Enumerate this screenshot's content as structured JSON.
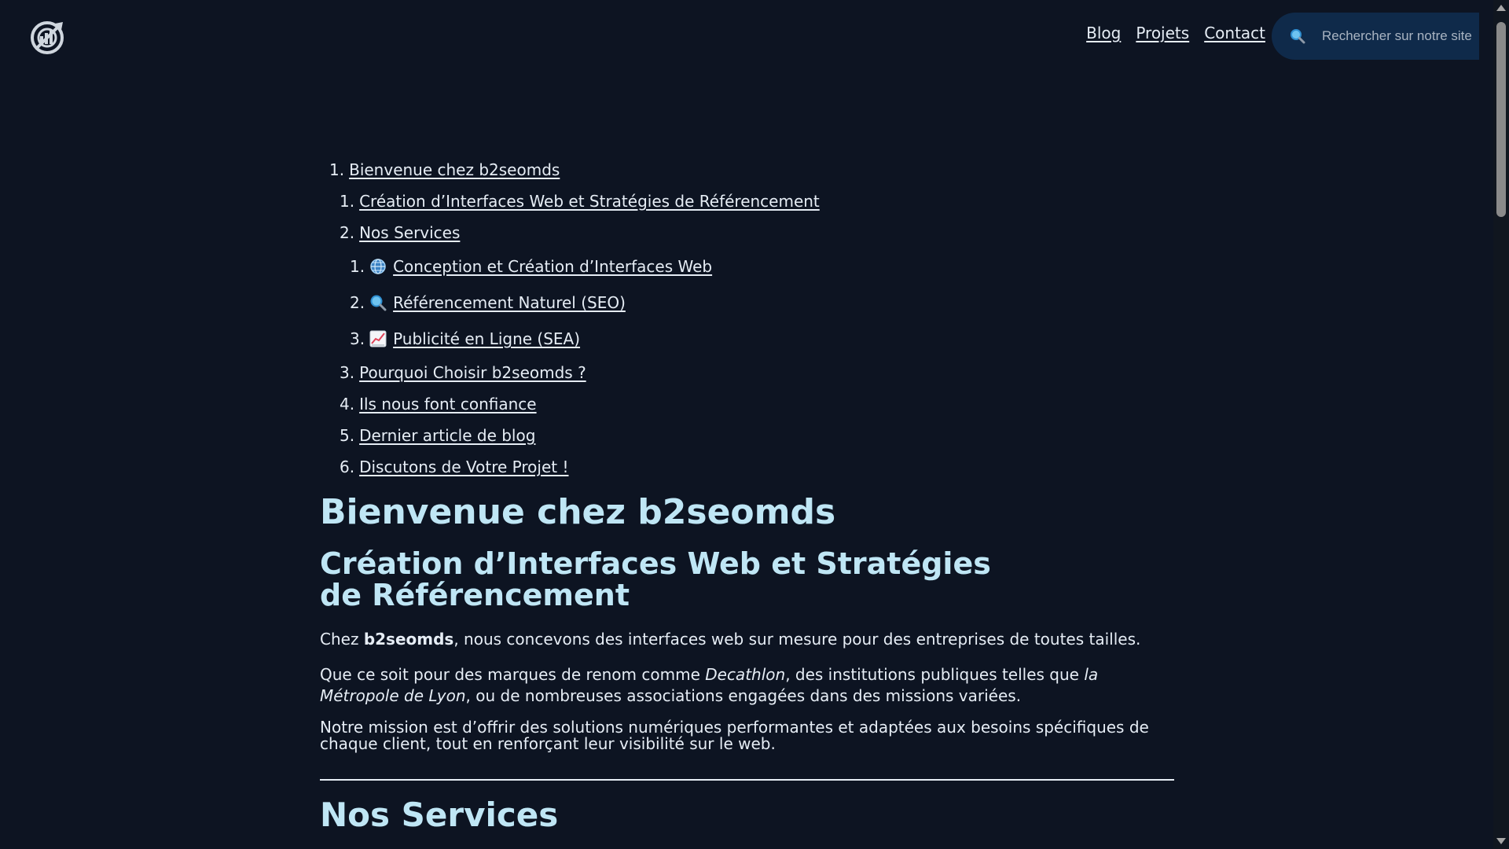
{
  "header": {
    "logo_alt": "b2seomds logo",
    "nav": [
      "Blog",
      "Projets",
      "Contact"
    ],
    "search_placeholder": "Rechercher sur notre site"
  },
  "toc": {
    "root": {
      "num": "1.",
      "label": "Bienvenue chez b2seomds"
    },
    "items": [
      {
        "num": "1.",
        "label": "Création d’Interfaces Web et Stratégies de Référencement"
      },
      {
        "num": "2.",
        "label": "Nos Services"
      },
      {
        "num": "3.",
        "label": "Pourquoi Choisir b2seomds ?"
      },
      {
        "num": "4.",
        "label": "Ils nous font confiance"
      },
      {
        "num": "5.",
        "label": "Dernier article de blog"
      },
      {
        "num": "6.",
        "label": "Discutons de Votre Projet !"
      }
    ],
    "services": [
      {
        "num": "1.",
        "icon": "globe-icon",
        "label": "Conception et Création d’Interfaces Web"
      },
      {
        "num": "2.",
        "icon": "magnifier-icon",
        "label": "Référencement Naturel (SEO)"
      },
      {
        "num": "3.",
        "icon": "chart-up-icon",
        "label": "Publicité en Ligne (SEA)"
      }
    ]
  },
  "main": {
    "h1": "Bienvenue chez b2seomds",
    "h2": "Création d’Interfaces Web et Stratégies de Référencement",
    "p1_prefix": "Chez ",
    "p1_brand": "b2seomds",
    "p1_suffix": ", nous concevons des interfaces web sur mesure pour des entreprises de toutes tailles.",
    "p2_a": "Que ce soit pour des marques de renom comme ",
    "p2_decathlon": "Decathlon",
    "p2_b": ", des institutions publiques telles que ",
    "p2_metropole": "la Métropole de Lyon",
    "p2_c": ", ou de nombreuses associations engagées dans des missions variées.",
    "p3": "Notre mission est d’offrir des solutions numériques performantes et adaptées aux besoins spécifiques de chaque client, tout en renforçant leur visibilité sur le web.",
    "section_title": "Nos Services"
  },
  "colors": {
    "background": "#0d1422",
    "heading": "#bfe6f5",
    "text": "#e6edf5",
    "search_bg": "#0f2a4a"
  }
}
